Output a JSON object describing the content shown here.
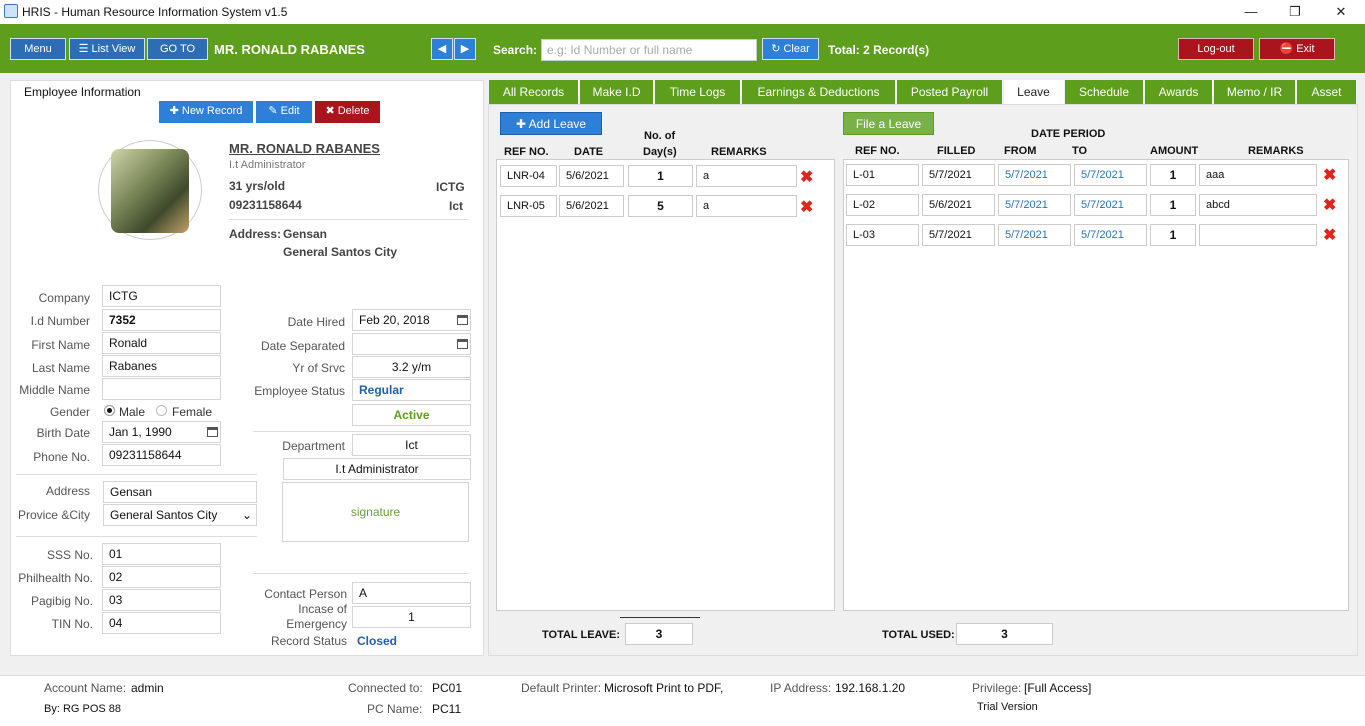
{
  "window": {
    "title": "HRIS - Human Resource Information System v1.5",
    "min": "—",
    "restore": "❐",
    "close": "✕"
  },
  "toolbar": {
    "menu": "Menu",
    "list_view": "List View",
    "goto": "GO TO",
    "employee_name": "MR. RONALD  RABANES",
    "search_label": "Search:",
    "search_placeholder": "e.g: Id Number or full name",
    "clear": "Clear",
    "total": "Total: 2 Record(s)",
    "logout": "Log-out",
    "exit": "Exit"
  },
  "left": {
    "section_title": "Employee Information",
    "new_record": "New Record",
    "edit": "Edit",
    "delete": "Delete",
    "profile": {
      "name": "MR. RONALD  RABANES",
      "position": "I.t Administrator",
      "age": "31 yrs/old",
      "company_code": "ICTG",
      "phone": "09231158644",
      "dept_code": "Ict",
      "address_label": "Address:",
      "address_line1": "Gensan",
      "address_line2": "General Santos City"
    },
    "labels": {
      "company": "Company",
      "id_number": "I.d Number",
      "first_name": "First Name",
      "last_name": "Last Name",
      "middle_name": "Middle Name",
      "gender": "Gender",
      "birth_date": "Birth Date",
      "phone": "Phone No.",
      "address": "Address",
      "province_city": "Provice &City",
      "sss": "SSS No.",
      "philhealth": "Philhealth No.",
      "pagibig": "Pagibig No.",
      "tin": "TIN No.",
      "date_hired": "Date Hired",
      "date_separated": "Date Separated",
      "yr_srvc": "Yr of Srvc",
      "emp_status": "Employee Status",
      "department": "Department",
      "contact_person": "Contact Person",
      "incase1": "Incase of",
      "incase2": "Emergency",
      "record_status": "Record Status"
    },
    "values": {
      "company": "ICTG",
      "id_number": "7352",
      "first_name": "Ronald",
      "last_name": "Rabanes",
      "middle_name": "",
      "male": "Male",
      "female": "Female",
      "birth_date": "Jan 1, 1990",
      "phone": "09231158644",
      "address": "Gensan",
      "province_city": "General Santos City",
      "sss": "01",
      "philhealth": "02",
      "pagibig": "03",
      "tin": "04",
      "date_hired": "Feb 20, 2018",
      "date_separated": "",
      "yr_srvc": "3.2 y/m",
      "emp_status": "Regular",
      "active": "Active",
      "department": "Ict",
      "position": "I.t Administrator",
      "signature": "signature",
      "contact_person": "A",
      "emergency": "1",
      "record_status": "Closed"
    }
  },
  "tabs": [
    "All Records",
    "Make I.D",
    "Time Logs",
    "Earnings & Deductions",
    "Posted Payroll",
    "Leave",
    "Schedule",
    "Awards",
    "Memo / IR",
    "Asset"
  ],
  "leave": {
    "add_leave": "Add Leave",
    "headers": {
      "ref": "REF NO.",
      "date": "DATE",
      "days1": "No. of",
      "days2": "Day(s)",
      "remarks": "REMARKS"
    },
    "rows": [
      {
        "ref": "LNR-04",
        "date": "5/6/2021",
        "days": "1",
        "remarks": "a"
      },
      {
        "ref": "LNR-05",
        "date": "5/6/2021",
        "days": "5",
        "remarks": "a"
      }
    ],
    "total_label": "TOTAL LEAVE:",
    "total": "3"
  },
  "file": {
    "file_leave": "File a Leave",
    "headers": {
      "period": "DATE PERIOD",
      "ref": "REF NO.",
      "filled": "FILLED",
      "from": "FROM",
      "to": "TO",
      "amount": "AMOUNT",
      "remarks": "REMARKS"
    },
    "rows": [
      {
        "ref": "L-01",
        "filled": "5/7/2021",
        "from": "5/7/2021",
        "to": "5/7/2021",
        "amount": "1",
        "remarks": "aaa"
      },
      {
        "ref": "L-02",
        "filled": "5/6/2021",
        "from": "5/7/2021",
        "to": "5/7/2021",
        "amount": "1",
        "remarks": "abcd"
      },
      {
        "ref": "L-03",
        "filled": "5/7/2021",
        "from": "5/7/2021",
        "to": "5/7/2021",
        "amount": "1",
        "remarks": ""
      }
    ],
    "total_label": "TOTAL USED:",
    "total": "3"
  },
  "footer": {
    "account_label": "Account Name:",
    "account": "admin",
    "by": "By: RG POS 88",
    "connected_label": "Connected to:",
    "connected": "PC01",
    "pc_label": "PC Name:",
    "pc": "PC11",
    "printer_label": "Default Printer:",
    "printer": "Microsoft Print to PDF,",
    "ip_label": "IP Address:",
    "ip": "192.168.1.20",
    "priv_label": "Privilege:",
    "priv": "[Full Access]",
    "trial": "Trial Version"
  }
}
